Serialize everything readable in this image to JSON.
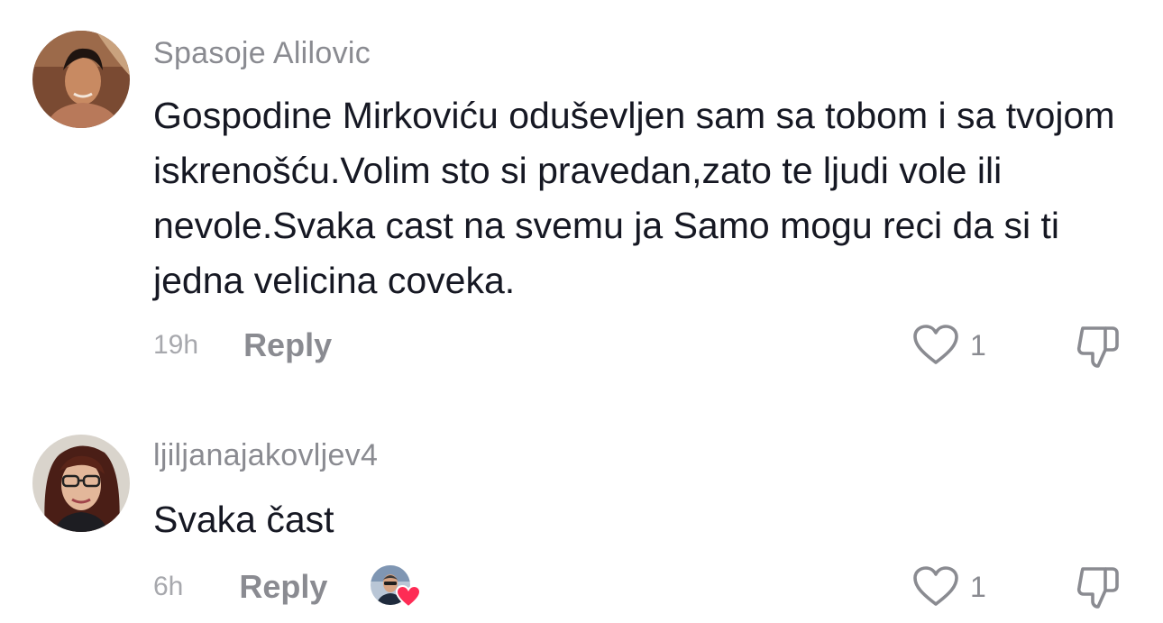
{
  "comments": [
    {
      "username": "Spasoje Alilovic",
      "text": "Gospodine Mirkoviću oduševljen sam sa tobom i sa tvojom iskrenošću.Volim sto si pravedan,zato te ljudi vole ili nevole.Svaka cast na svemu ja Samo mogu reci da si ti jedna velicina coveka.",
      "time": "19h",
      "reply_label": "Reply",
      "like_count": "1"
    },
    {
      "username": "ljiljanajakovljev4",
      "text": "Svaka čast",
      "time": "6h",
      "reply_label": "Reply",
      "like_count": "1",
      "liked_by_creator": true
    }
  ],
  "colors": {
    "text": "#161823",
    "secondary": "#8a8b91",
    "time": "#a7a8ad",
    "heart_badge": "#fe2c55"
  },
  "icons": {
    "like": "heart-outline-icon",
    "dislike": "thumbs-down-outline-icon",
    "creator_like": "heart-filled-icon"
  }
}
